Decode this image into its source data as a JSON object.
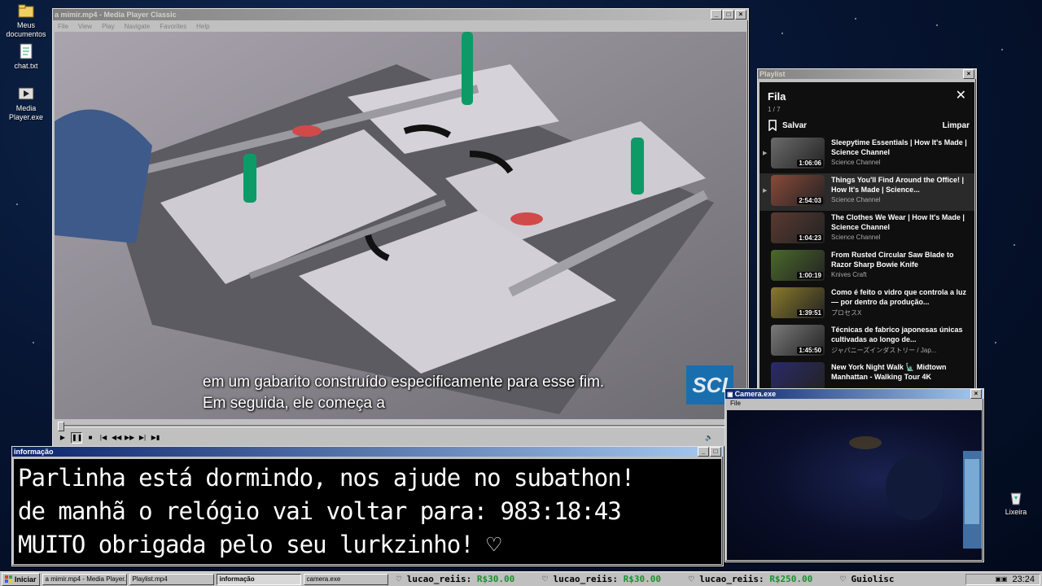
{
  "desktop": {
    "icons": [
      {
        "label": "Meus documentos"
      },
      {
        "label": "chat.txt"
      },
      {
        "label": "Media Player.exe"
      },
      {
        "label": "Lixeira"
      }
    ]
  },
  "player": {
    "title": "a mimir.mp4 - Media Player Classic",
    "menu": [
      "File",
      "View",
      "Play",
      "Navigate",
      "Favorites",
      "Help"
    ],
    "subtitle_line1": "em um gabarito construído especificamente para esse fim.",
    "subtitle_line2": "Em seguida, ele começa a",
    "logo_text": "SCI"
  },
  "playlist": {
    "window_title": "Playlist",
    "title": "Fila",
    "count": "1 / 7",
    "save_label": "Salvar",
    "clear_label": "Limpar",
    "items": [
      {
        "title": "Sleepytime Essentials | How It's Made | Science Channel",
        "channel": "Science Channel",
        "duration": "1:06:06",
        "color": "#6b6b6b"
      },
      {
        "title": "Things You'll Find Around the Office! | How It's Made | Science...",
        "channel": "Science Channel",
        "duration": "2:54:03",
        "color": "#8a4a3a"
      },
      {
        "title": "The Clothes We Wear | How It's Made | Science Channel",
        "channel": "Science Channel",
        "duration": "1:04:23",
        "color": "#5a3a30"
      },
      {
        "title": "From Rusted Circular Saw Blade to Razor Sharp Bowie Knife",
        "channel": "Knives Craft",
        "duration": "1:00:19",
        "color": "#4a6a2a"
      },
      {
        "title": "Como é feito o vidro que controla a luz — por dentro da produção...",
        "channel": "プロセスX",
        "duration": "1:39:51",
        "color": "#8a7a2a"
      },
      {
        "title": "Técnicas de fabrico japonesas únicas cultivadas ao longo de...",
        "channel": "ジャパニーズインダストリー / Jap...",
        "duration": "1:45:50",
        "color": "#7a7a7a"
      },
      {
        "title": "New York Night Walk 🗽 Midtown Manhattan - Walking Tour 4K",
        "channel": "",
        "duration": "",
        "color": "#2a2a6a"
      }
    ]
  },
  "info": {
    "window_title": "informação",
    "line1": "Parlinha está dormindo, nos ajude no subathon!",
    "line2": "de manhã o relógio vai voltar para:  983:18:43",
    "line3": "MUITO obrigada pelo seu lurkzinho! ♡"
  },
  "camera": {
    "window_title": "Camera.exe",
    "menu_file": "File"
  },
  "taskbar": {
    "start": "Iniciar",
    "tasks": [
      "a mimir.mp4 - Media Player...",
      "Playlist.mp4",
      "informação",
      "camera.exe"
    ],
    "ticker": [
      {
        "user": "lucao_reiis:",
        "amount": "R$30.00"
      },
      {
        "user": "lucao_reiis:",
        "amount": "R$30.00"
      },
      {
        "user": "lucao_reiis:",
        "amount": "R$250.00"
      },
      {
        "user": "Guiolisc",
        "amount": ""
      }
    ],
    "clock": "23:24"
  },
  "colors": {
    "title_active": "#0a246a",
    "ticker_amount": "#1a8f2f",
    "chrome": "#c0c0c0"
  }
}
